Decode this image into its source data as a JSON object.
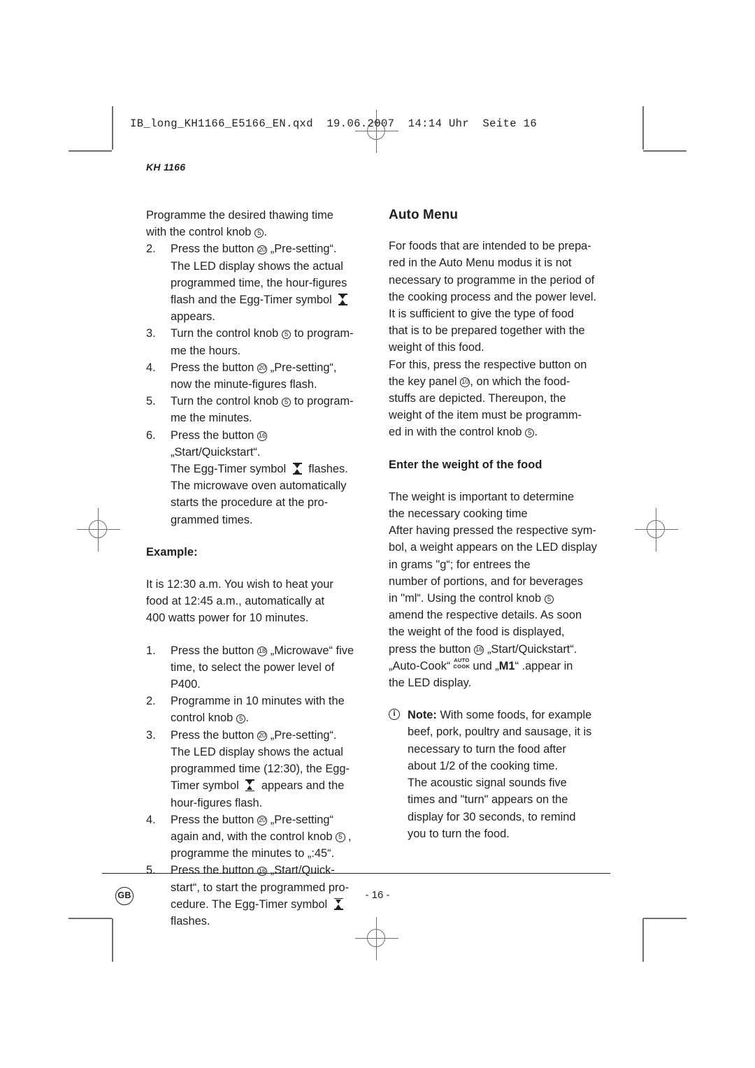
{
  "prepress": {
    "qxd_header": "IB_long_KH1166_E5166_EN.qxd  19.06.2007  14:14 Uhr  Seite 16"
  },
  "model_label": "KH 1166",
  "left_column": {
    "intro_step_lines": [
      "Programme the desired thawing time",
      "with the control knob ⑤."
    ],
    "steps": [
      {
        "num": "2.",
        "lines": [
          "Press the button ⑳ „Pre-setting“.",
          "The LED display shows the actual",
          "programmed time, the hour-figures",
          "flash and the Egg-Timer symbol ⧖",
          "appears."
        ]
      },
      {
        "num": "3.",
        "lines": [
          "Turn the control knob ⑤ to program-",
          "me the hours."
        ]
      },
      {
        "num": "4.",
        "lines": [
          "Press the button ⑳ „Pre-setting“,",
          "now the minute-figures flash."
        ]
      },
      {
        "num": "5.",
        "lines": [
          "Turn the control knob ⑤ to program-",
          "me the minutes."
        ]
      },
      {
        "num": "6.",
        "lines": [
          "Press the button ⑯ „Start/Quickstart“.",
          "The Egg-Timer symbol ⧖ flashes.",
          "The microwave oven automatically",
          "starts the procedure at the pro-",
          "grammed times."
        ]
      }
    ],
    "example_heading": "Example:",
    "example_paragraph_lines": [
      "It is 12:30 a.m. You wish to heat your",
      "food at 12:45 a.m., automatically at",
      "400 watts power for 10 minutes."
    ],
    "example_steps": [
      {
        "num": "1.",
        "lines": [
          "Press the button ⑱ „Microwave“ five",
          "time, to select the power level of",
          "P400."
        ]
      },
      {
        "num": "2.",
        "lines": [
          "Programme in 10 minutes with the",
          "control knob ⑤."
        ]
      },
      {
        "num": "3.",
        "lines": [
          "Press the button ⑳ „Pre-setting“.",
          "The LED display shows the actual",
          "programmed time (12:30), the Egg-",
          "Timer symbol ⧖ appears and the",
          "hour-figures flash."
        ]
      },
      {
        "num": "4.",
        "lines": [
          "Press the button ⑳ „Pre-setting“",
          "again and, with the control knob ⑤ ,",
          "programme the minutes to „:45“."
        ]
      },
      {
        "num": "5.",
        "lines": [
          "Press the button ⑯ „Start/Quick-",
          "start“, to start the programmed pro-",
          "cedure. The Egg-Timer symbol ⧖",
          "flashes."
        ]
      }
    ]
  },
  "right_column": {
    "heading": "Auto Menu",
    "paragraph_1_lines": [
      "For foods that are intended to be prepa-",
      "red in the Auto Menu modus it is not",
      "necessary to programme in the period of",
      "the cooking process and the power level.",
      "It is sufficient to give the type of food",
      "that is to be prepared together with the",
      "weight of this food."
    ],
    "paragraph_2_lines": [
      "For this, press the respective button on",
      "the key panel ⑩, on which the food-",
      "stuffs are depicted. Thereupon, the",
      "weight of the item must be programm-",
      "ed in with the control knob ⑤."
    ],
    "subheading": "Enter the weight of the food",
    "paragraph_3_lines": [
      "The weight is important to determine",
      "the necessary cooking time",
      "After having pressed the respective sym-",
      "bol, a weight appears on the LED display",
      "in grams \"g“; for entrees the",
      "number of portions, and for beverages",
      "in \"ml“. Using the control knob ⑤",
      "amend the respective details. As soon",
      "the weight of the food is displayed,",
      "press the button ⑯ „Start/Quickstart“.",
      "„Auto-Cook“ AUTO-COOK und „M1“ .appear in",
      "the LED display."
    ],
    "autocook_glyph": {
      "line1": "AUTO",
      "line2": "COOK"
    },
    "note": {
      "label": "Note:",
      "icon": "info-icon",
      "lines": [
        "With some foods, for example",
        "beef, pork, poultry and sausage, it is",
        "necessary to turn the food after",
        "about 1/2 of the cooking time.",
        "The acoustic signal sounds five",
        "times and \"turn\" appears on the",
        "display for 30 seconds, to remind",
        "you to turn the food."
      ]
    },
    "inline": {
      "und": "und",
      "m1": "M1",
      "auto_cook_label": "„Auto-Cook“",
      "appear_tail": ".appear in"
    }
  },
  "footer": {
    "language_badge": "GB",
    "page_number": "- 16 -"
  },
  "refs": {
    "knob": "5",
    "presetting": "20",
    "start": "16",
    "microwave": "18",
    "keypanel": "10"
  }
}
